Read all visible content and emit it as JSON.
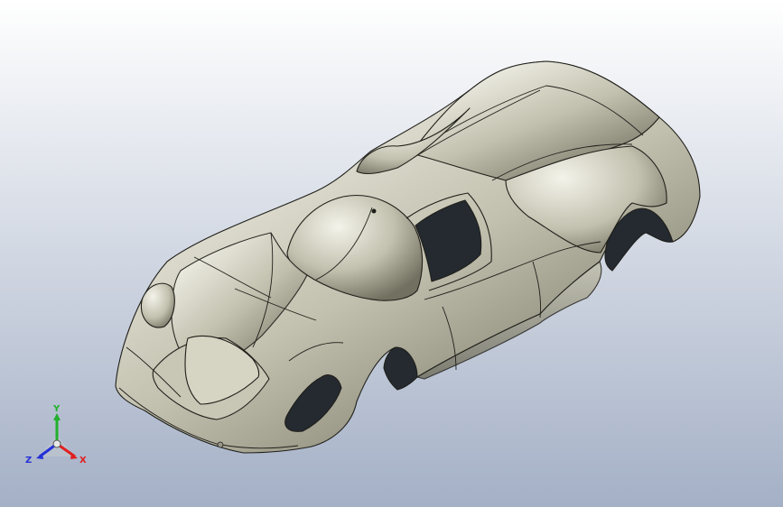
{
  "viewport": {
    "background_top": "#ffffff",
    "background_bottom": "#a4b0c6"
  },
  "model": {
    "body_color_light": "#f4f3ea",
    "body_color_mid": "#c2c0ae",
    "body_color_dark": "#727060",
    "edge_color": "#1f1f1a",
    "opening_color": "#242a30"
  },
  "triad": {
    "y_label": "Y",
    "z_label": "Z",
    "x_label": "X",
    "y_color": "#22b02c",
    "z_color": "#2430d8",
    "x_color": "#e02020"
  }
}
